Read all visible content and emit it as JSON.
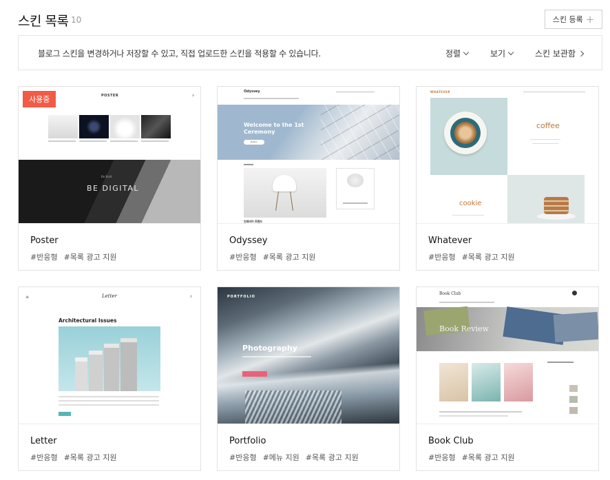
{
  "header": {
    "title": "스킨 목록",
    "count": "10",
    "register_label": "스킨 등록"
  },
  "info_bar": {
    "text": "블로그 스킨을 변경하거나 저장할 수 있고, 직접 업로드한 스킨을 적용할 수 있습니다.",
    "sort_label": "정렬",
    "view_label": "보기",
    "storage_label": "스킨 보관함"
  },
  "skins": [
    {
      "name": "Poster",
      "tags": [
        "#반응형",
        "#목록 광고 지원"
      ],
      "badge": "사용중",
      "preview": {
        "logo": "POSTER",
        "banner": "BE DIGITAL",
        "banner_small": "Be Bold"
      }
    },
    {
      "name": "Odyssey",
      "tags": [
        "#반응형",
        "#목록 광고 지원"
      ],
      "preview": {
        "logo": "Odyssey",
        "hero": "Welcome to the 1st Ceremony",
        "hero_btn": "Button",
        "section": "인테리어 트렌드"
      }
    },
    {
      "name": "Whatever",
      "tags": [
        "#반응형",
        "#목록 광고 지원"
      ],
      "preview": {
        "logo": "WHATEVER",
        "word1": "coffee",
        "word2": "cookie"
      }
    },
    {
      "name": "Letter",
      "tags": [
        "#반응형",
        "#목록 광고 지원"
      ],
      "preview": {
        "logo": "Letter",
        "headline": "Architectural Issues"
      }
    },
    {
      "name": "Portfolio",
      "tags": [
        "#반응형",
        "#메뉴 지원",
        "#목록 광고 지원"
      ],
      "preview": {
        "logo": "PORTFOLIO",
        "headline": "Photography"
      }
    },
    {
      "name": "Book Club",
      "tags": [
        "#반응형",
        "#목록 광고 지원"
      ],
      "preview": {
        "logo": "Book Club",
        "banner": "Book Review"
      }
    }
  ],
  "colors": {
    "badge": "#f25b46",
    "border": "#e2e2e2",
    "accent_pink": "#e8637a"
  }
}
